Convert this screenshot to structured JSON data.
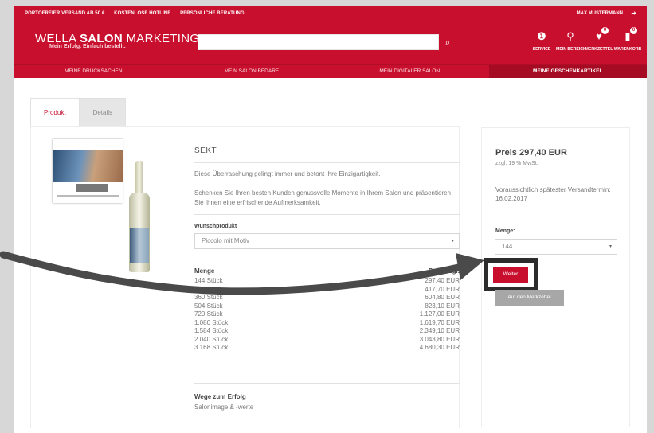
{
  "header": {
    "topbar": [
      "PORTOFREIER VERSAND AB 50 €",
      "KOSTENLOSE HOTLINE",
      "PERSÖNLICHE BERATUNG"
    ],
    "user_name": "MAX MUSTERMANN",
    "logo_regular": "WELLA ",
    "logo_bold": "SALON",
    "logo_rest": " MARKETING",
    "tagline": "Mein Erfolg. Einfach bestellt.",
    "search_placeholder": "",
    "icons": [
      {
        "icon": "info-icon",
        "glyph": "i",
        "label": "SERVICE",
        "badge": ""
      },
      {
        "icon": "user-icon",
        "glyph": "👤",
        "label": "MEIN BEREICH",
        "badge": ""
      },
      {
        "icon": "heart-icon",
        "glyph": "♥",
        "label": "MERKZETTEL",
        "badge": "0"
      },
      {
        "icon": "cart-icon",
        "glyph": "🛍",
        "label": "WARENKORB",
        "badge": "0"
      }
    ]
  },
  "nav": [
    "MEINE DRUCKSACHEN",
    "MEIN SALON BEDARF",
    "MEIN DIGITALER SALON",
    "MEINE GESCHENKARTIKEL"
  ],
  "nav_active_index": 3,
  "tabs": [
    "Produkt",
    "Details"
  ],
  "product": {
    "title": "SEKT",
    "desc1": "Diese Überraschung gelingt immer und betont Ihre Einzigartigkeit.",
    "desc2": "Schenken Sie Ihren besten Kunden genussvolle Momente in Ihrem Salon und präsentieren Sie Ihnen eine erfrischende Aufmerksamkeit.",
    "wunsch_label": "Wunschprodukt",
    "wunsch_value": "Piccolo mit Motiv",
    "menge_header": "Menge",
    "preis_header": "Preis zzgl.",
    "rows": [
      {
        "qty": "144 Stück",
        "price": "297,40 EUR"
      },
      {
        "qty": "240 Stück",
        "price": "417,70 EUR"
      },
      {
        "qty": "360 Stück",
        "price": "604,80 EUR"
      },
      {
        "qty": "504 Stück",
        "price": "823,10 EUR"
      },
      {
        "qty": "720 Stück",
        "price": "1.127,00 EUR"
      },
      {
        "qty": "1.080 Stück",
        "price": "1.619,70 EUR"
      },
      {
        "qty": "1.584 Stück",
        "price": "2.349,10 EUR"
      },
      {
        "qty": "2.040 Stück",
        "price": "3.043,80 EUR"
      },
      {
        "qty": "3.168 Stück",
        "price": "4.680,30 EUR"
      }
    ],
    "wege_title": "Wege zum Erfolg",
    "wege_sub": "Salonimage & -werte"
  },
  "side": {
    "price": "Preis 297,40 EUR",
    "vat": "zzgl. 19 % MwSt.",
    "delivery": "Voraussichtlich spätester Versandtermin: 16.02.2017",
    "menge_label": "Menge:",
    "menge_value": "144",
    "weiter": "Weiter",
    "merkzettel": "Auf den Merkzettel"
  },
  "colors": {
    "brand": "#c8102e",
    "annotation": "#2c2c2c"
  }
}
